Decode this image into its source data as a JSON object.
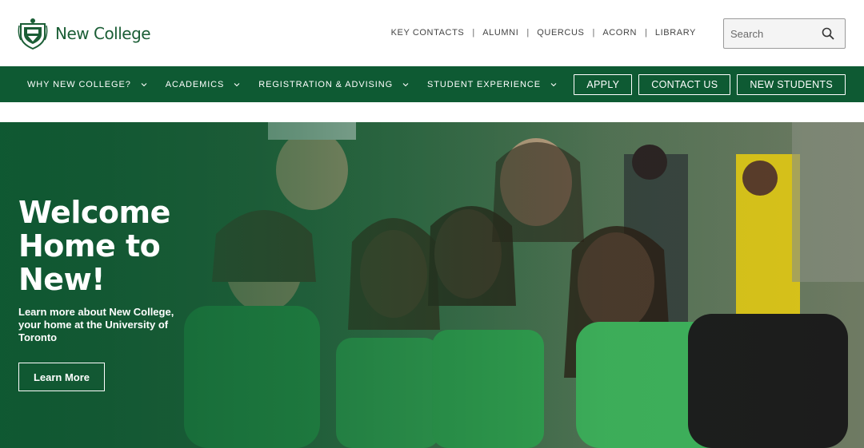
{
  "brand": {
    "name": "New College",
    "green": "#0e5a33",
    "logo_icon": "crest-icon"
  },
  "utility_nav": {
    "items": [
      {
        "label": "KEY CONTACTS"
      },
      {
        "label": "ALUMNI"
      },
      {
        "label": "QUERCUS"
      },
      {
        "label": "ACORN"
      },
      {
        "label": "LIBRARY"
      }
    ],
    "separator": "|"
  },
  "search": {
    "placeholder": "Search",
    "value": "",
    "icon": "search-icon"
  },
  "main_nav": {
    "items": [
      {
        "label": "WHY NEW COLLEGE?",
        "icon": "chevron-down-icon"
      },
      {
        "label": "ACADEMICS",
        "icon": "chevron-down-icon"
      },
      {
        "label": "REGISTRATION & ADVISING",
        "icon": "chevron-down-icon"
      },
      {
        "label": "STUDENT EXPERIENCE",
        "icon": "chevron-down-icon"
      }
    ],
    "buttons": [
      {
        "label": "APPLY"
      },
      {
        "label": "CONTACT US"
      },
      {
        "label": "NEW STUDENTS"
      }
    ]
  },
  "hero": {
    "title": "Welcome Home to New!",
    "subtitle": "Learn more about New College, your home at the University of Toronto",
    "cta_label": "Learn More",
    "overlay_color": "#0e5a33"
  }
}
